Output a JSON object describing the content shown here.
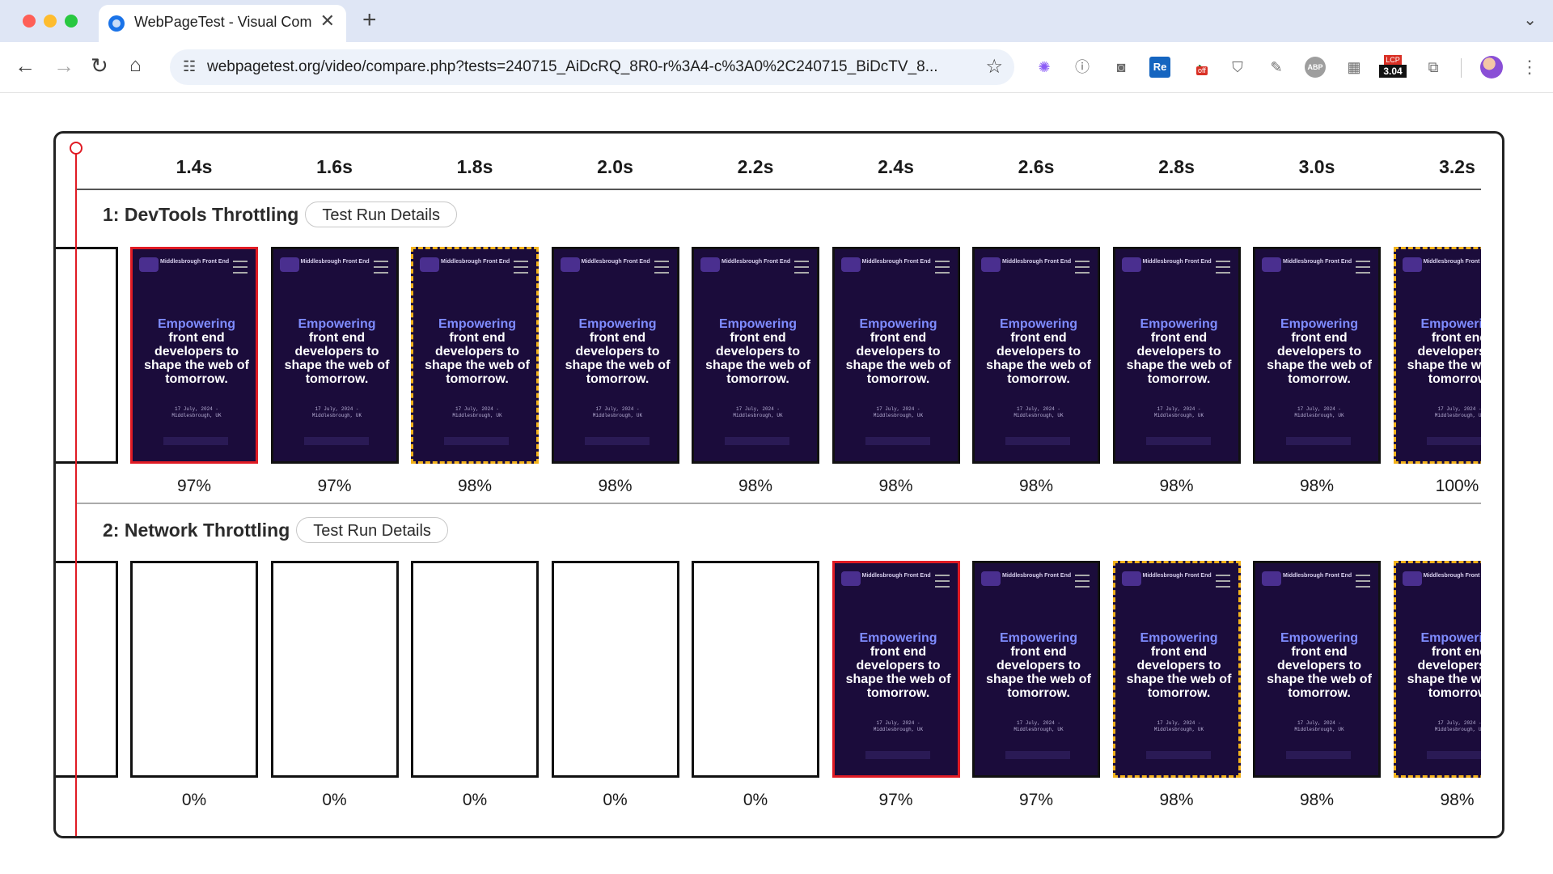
{
  "browser": {
    "tab_title": "WebPageTest - Visual Compari",
    "new_tab_symbol": "+",
    "close_symbol": "✕",
    "url": "webpagetest.org/video/compare.php?tests=240715_AiDcRQ_8R0-r%3A4-c%3A0%2C240715_BiDcTV_8...",
    "lcp_label": "LCP",
    "lcp_value": "3.04",
    "ext_off_label": "off"
  },
  "timeline": [
    "1.4s",
    "1.6s",
    "1.8s",
    "2.0s",
    "2.2s",
    "2.4s",
    "2.6s",
    "2.8s",
    "3.0s",
    "3.2s"
  ],
  "thumb_content": {
    "brand": "Middlesbrough Front End",
    "accent": "Empowering",
    "hero": "front end developers to shape the web of tomorrow.",
    "date": "17 July, 2024 -",
    "location": "Middlesbrough, UK"
  },
  "rows": [
    {
      "title": "1: DevTools Throttling",
      "button": "Test Run Details",
      "frames": [
        {
          "state": "filled",
          "border": "key",
          "pct": "97%"
        },
        {
          "state": "filled",
          "border": "normal",
          "pct": "97%"
        },
        {
          "state": "filled",
          "border": "changed",
          "pct": "98%"
        },
        {
          "state": "filled",
          "border": "normal",
          "pct": "98%"
        },
        {
          "state": "filled",
          "border": "normal",
          "pct": "98%"
        },
        {
          "state": "filled",
          "border": "normal",
          "pct": "98%"
        },
        {
          "state": "filled",
          "border": "normal",
          "pct": "98%"
        },
        {
          "state": "filled",
          "border": "normal",
          "pct": "98%"
        },
        {
          "state": "filled",
          "border": "normal",
          "pct": "98%"
        },
        {
          "state": "filled",
          "border": "changed",
          "pct": "100%"
        }
      ]
    },
    {
      "title": "2: Network Throttling",
      "button": "Test Run Details",
      "frames": [
        {
          "state": "blank",
          "border": "normal",
          "pct": "0%"
        },
        {
          "state": "blank",
          "border": "normal",
          "pct": "0%"
        },
        {
          "state": "blank",
          "border": "normal",
          "pct": "0%"
        },
        {
          "state": "blank",
          "border": "normal",
          "pct": "0%"
        },
        {
          "state": "blank",
          "border": "normal",
          "pct": "0%"
        },
        {
          "state": "filled",
          "border": "key",
          "pct": "97%"
        },
        {
          "state": "filled",
          "border": "normal",
          "pct": "97%"
        },
        {
          "state": "filled",
          "border": "changed",
          "pct": "98%"
        },
        {
          "state": "filled",
          "border": "normal",
          "pct": "98%"
        },
        {
          "state": "filled",
          "border": "changed",
          "pct": "98%"
        }
      ]
    }
  ],
  "colors": {
    "key_frame": "#e01b24",
    "changed_frame": "#f2b21a",
    "thumb_bg": "#1b0c3b",
    "accent": "#7f8cff"
  }
}
